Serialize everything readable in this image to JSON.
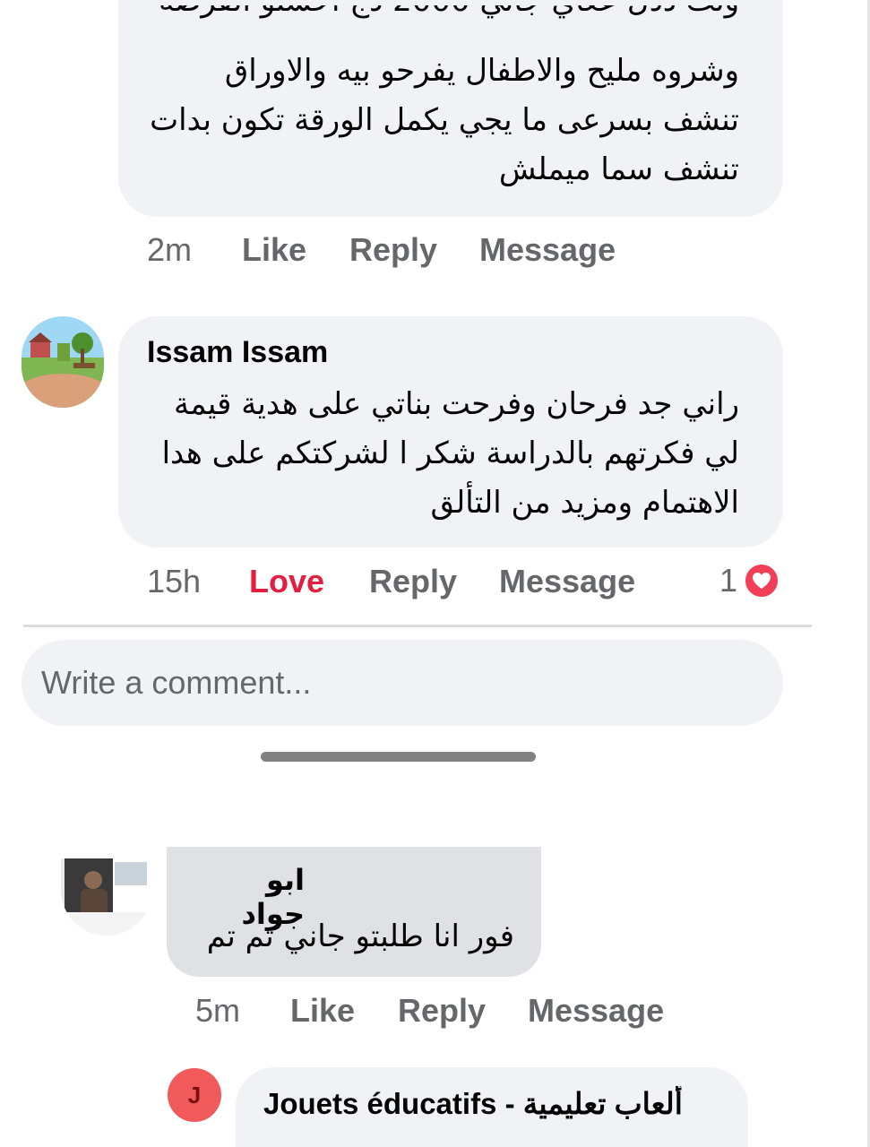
{
  "comments": [
    {
      "partial": true,
      "text_lines_rtl": [
        "وشروه مليح والاطفال يفرحو بيه والاوراق",
        "تنشف بسرعى ما يجي يكمل الورقة تكون بدات",
        "تنشف سما ميملش"
      ],
      "time": "2m",
      "like_label": "Like",
      "reply_label": "Reply",
      "message_label": "Message"
    },
    {
      "author": "Issam Issam",
      "text_lines_rtl": [
        "راني جد فرحان وفرحت بناتي على هدية قيمة",
        "لي فكرتهم بالدراسة شكر ا لشركتكم على هدا",
        "الاهتمام ومزيد من التألق"
      ],
      "time": "15h",
      "reaction_label": "Love",
      "reply_label": "Reply",
      "message_label": "Message",
      "reaction_count": "1",
      "reaction_icon": "heart-icon",
      "reaction_color": "#e41e3f"
    }
  ],
  "comment_input": {
    "placeholder": "Write a comment..."
  },
  "second_thread": {
    "comment": {
      "author": "ابو جواد",
      "text": "فور انا طلبتو جاني تم تم",
      "time": "5m",
      "like_label": "Like",
      "reply_label": "Reply",
      "message_label": "Message"
    },
    "reply": {
      "avatar_letter": "J",
      "author": "Jouets éducatifs - ألعاب تعليمية"
    }
  },
  "colors": {
    "bubble": "#f0f2f5",
    "bubble_grey": "#dfe1e5",
    "secondary_text": "#65676b",
    "love": "#e41e3f",
    "heart_badge": "#f33e58"
  }
}
